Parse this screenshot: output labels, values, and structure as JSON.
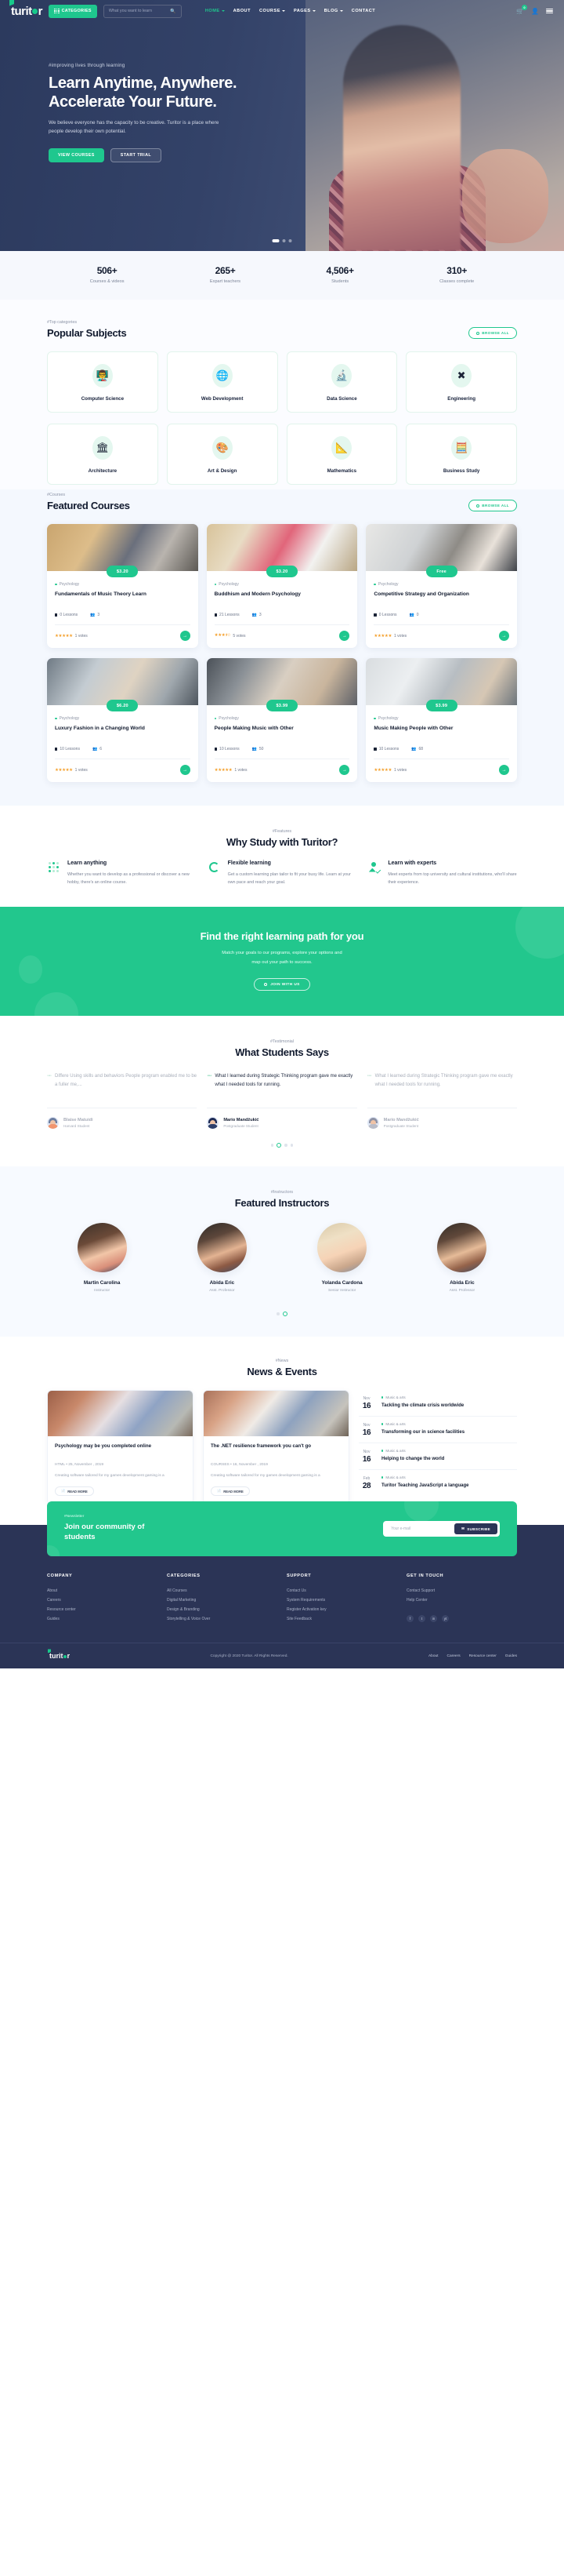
{
  "brand": {
    "name_start": "turit",
    "name_end": "r",
    "accent": "#1fc78e",
    "dark": "#2b3456"
  },
  "header": {
    "categories_label": "CATEGORIES",
    "search_placeholder": "What you want to learn",
    "search_value": "",
    "cart_count": "0",
    "nav": [
      {
        "label": "HOME",
        "active": true,
        "caret": true
      },
      {
        "label": "ABOUT",
        "active": false,
        "caret": false
      },
      {
        "label": "COURSE",
        "active": false,
        "caret": true
      },
      {
        "label": "PAGES",
        "active": false,
        "caret": true
      },
      {
        "label": "BLOG",
        "active": false,
        "caret": true
      },
      {
        "label": "CONTACT",
        "active": false,
        "caret": false
      }
    ]
  },
  "hero": {
    "tagline": "#improving lives through learning",
    "title_line1": "Learn Anytime, Anywhere.",
    "title_line2": "Accelerate Your Future.",
    "subtitle": "We believe everyone has the capacity to be creative. Turitor is a place where people develop their own potential.",
    "btn_primary": "VIEW COURSES",
    "btn_secondary": "START TRIAL"
  },
  "stats": [
    {
      "value": "506+",
      "label": "Courses & videos"
    },
    {
      "value": "265+",
      "label": "Expart teachers"
    },
    {
      "value": "4,506+",
      "label": "Students"
    },
    {
      "value": "310+",
      "label": "Classes complete"
    }
  ],
  "subjects": {
    "eyebrow": "#Top categories",
    "title": "Popular Subjects",
    "browse": "BROWSE ALL",
    "items": [
      {
        "name": "Computer Science",
        "icon": "👨‍🏫"
      },
      {
        "name": "Web Development",
        "icon": "🌐"
      },
      {
        "name": "Data Science",
        "icon": "🔬"
      },
      {
        "name": "Engineering",
        "icon": "✖"
      },
      {
        "name": "Architecture",
        "icon": "🏛"
      },
      {
        "name": "Art & Design",
        "icon": "🎨"
      },
      {
        "name": "Mathematics",
        "icon": "📐"
      },
      {
        "name": "Business Study",
        "icon": "🧮"
      }
    ]
  },
  "courses": {
    "eyebrow": "#Courses",
    "title": "Featured Courses",
    "browse": "BROWSE ALL",
    "items": [
      {
        "price": "$3.20",
        "category": "Psychology",
        "name": "Fundamentals of Music Theory Learn",
        "lessons": "0 Lessons",
        "students": "3",
        "stars": 5,
        "votes": "1 votes"
      },
      {
        "price": "$3.20",
        "category": "Psychology",
        "name": "Buddhism and Modern Psychology",
        "lessons": "21 Lessons",
        "students": "3",
        "stars": 3.5,
        "votes": "5 votes"
      },
      {
        "price": "Free",
        "category": "Psychology",
        "name": "Competitive Strategy and Organization",
        "lessons": "0 Lessons",
        "students": "0",
        "stars": 5,
        "votes": "1 votes"
      },
      {
        "price": "$6.20",
        "category": "Psychology",
        "name": "Luxury Fashion in a Changing World",
        "lessons": "10 Lessons",
        "students": "6",
        "stars": 5,
        "votes": "1 votes"
      },
      {
        "price": "$3.99",
        "category": "Psychology",
        "name": "People Making Music with Other",
        "lessons": "10 Lessons",
        "students": "50",
        "stars": 5,
        "votes": "1 votes"
      },
      {
        "price": "$3.99",
        "category": "Psychology",
        "name": "Music Making People with Other",
        "lessons": "10 Lessons",
        "students": "68",
        "stars": 5,
        "votes": "1 votes"
      }
    ]
  },
  "features": {
    "eyebrow": "#Features",
    "title": "Why Study with Turitor?",
    "items": [
      {
        "icon": "dots-icon",
        "title": "Learn anything",
        "text": "Whether you want to develop as a professional or discover a new hobby, there's an online course."
      },
      {
        "icon": "ring-icon",
        "title": "Flexible learning",
        "text": "Get a custom learning plan tailor to fit your busy life. Learn at your own pace and reach your goal."
      },
      {
        "icon": "expert-icon",
        "title": "Learn with experts",
        "text": "Meet experts from top university and cultural institutions, who'll share their experience."
      }
    ]
  },
  "cta": {
    "title": "Find the right learning path for you",
    "text_line1": "Match your goals to our programs, explore your options and",
    "text_line2": "map out your path to success.",
    "button": "JOIN WITH US"
  },
  "testimonial": {
    "eyebrow": "#Testimonial",
    "title": "What Students Says",
    "items": [
      {
        "quote": "Differe Using skills and behaviors People program enabled me to be a fuller me,...",
        "name": "Blaise Matuidi",
        "role": "Harvard Student",
        "active": false
      },
      {
        "quote": "What I learned during Strategic Thinking program gave me exactly what I needed tools for running.",
        "name": "Mario Mandžukić",
        "role": "Postgraduate Student",
        "active": true
      },
      {
        "quote": "What I learned during Strategic Thinking program gave me exactly what I needed tools for running.",
        "name": "Mario Mandžukić",
        "role": "Postgraduate Student",
        "active": false
      }
    ]
  },
  "instructors": {
    "eyebrow": "#Instructors",
    "title": "Featured Instructors",
    "items": [
      {
        "name": "Martin Carolina",
        "role": "Instructor"
      },
      {
        "name": "Abida Eric",
        "role": "Asst. Professor"
      },
      {
        "name": "Yolanda Cardona",
        "role": "Senior Instructor"
      },
      {
        "name": "Abida Eric",
        "role": "Asst. Professor"
      }
    ]
  },
  "news": {
    "eyebrow": "#News",
    "title": "News & Events",
    "posts": [
      {
        "title": "Psychology may be you completed online",
        "meta": "HTML  •  25, November , 2019",
        "text": "Creating software tailored for my games development gaming is a",
        "more": "READ MORE"
      },
      {
        "title": "The .NET resilience framework you can't go",
        "meta": "COURSES  •  16, November , 2019",
        "text": "Creating software tailored for my games development gaming is a",
        "more": "READ MORE"
      }
    ],
    "events": [
      {
        "month": "Nov",
        "day": "16",
        "category": "Music & arts",
        "title": "Tackling the climate crisis worldwide"
      },
      {
        "month": "Nov",
        "day": "16",
        "category": "Music & arts",
        "title": "Transforming our in science facilities"
      },
      {
        "month": "Nov",
        "day": "16",
        "category": "Music & arts",
        "title": "Helping to change the world"
      },
      {
        "month": "Feb",
        "day": "28",
        "category": "Music & arts",
        "title": "Turitor Teaching JavaScript a language"
      }
    ]
  },
  "subscribe": {
    "eyebrow": "#Newsletter",
    "title": "Join our community of students",
    "placeholder": "Your e-mail",
    "value": "",
    "button": "SUBSCRIBE"
  },
  "footer": {
    "columns": [
      {
        "heading": "COMPANY",
        "links": [
          "About",
          "Careers",
          "Resource center",
          "Guides"
        ]
      },
      {
        "heading": "CATEGORIES",
        "links": [
          "All Courses",
          "Digital Marketing",
          "Design & Branding",
          "Storytelling & Voice Over"
        ]
      },
      {
        "heading": "SUPPORT",
        "links": [
          "Contact Us",
          "System Requirements",
          "Register Activation key",
          "Site Feedback"
        ]
      },
      {
        "heading": "GET IN TOUCH",
        "links": [
          "Contact Support",
          "Help Center"
        ]
      }
    ],
    "social": [
      "f",
      "t",
      "in",
      "yt"
    ],
    "copyright": "Copyright @ 2020 Turitor. All Rights Reserved.",
    "bottom_links": [
      "About",
      "Careers",
      "Resource center",
      "Guides"
    ]
  }
}
